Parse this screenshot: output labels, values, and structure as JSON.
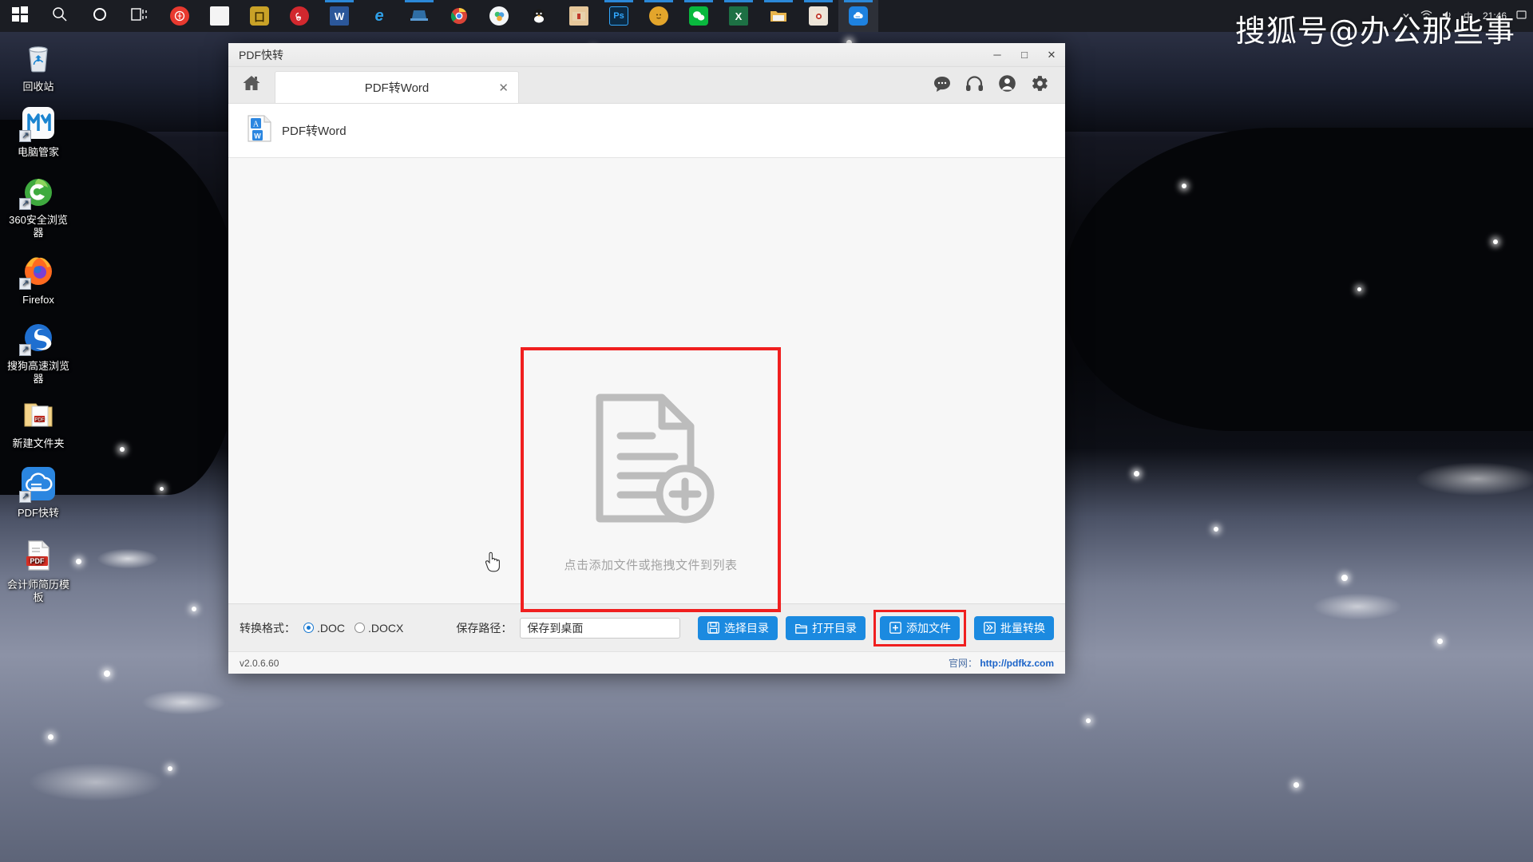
{
  "taskbar": {
    "start_label": "start-icon",
    "items": [
      {
        "name": "start",
        "glyph": "win",
        "color": "#ffffff",
        "running": false
      },
      {
        "name": "search",
        "glyph": "search",
        "color": "#ffffff",
        "running": false
      },
      {
        "name": "cortana",
        "glyph": "circle",
        "color": "#ffffff",
        "running": false
      },
      {
        "name": "task-view",
        "glyph": "taskview",
        "color": "#ffffff",
        "running": false
      },
      {
        "name": "adobe-acrobat",
        "glyph": "A",
        "color": "#e8392f",
        "running": false
      },
      {
        "name": "notepad",
        "glyph": "doc",
        "color": "#f0f0f0",
        "running": false
      },
      {
        "name": "sogou-input",
        "glyph": "S",
        "color": "#c9a227",
        "running": false
      },
      {
        "name": "netease-music",
        "glyph": "M",
        "color": "#d2282e",
        "running": false
      },
      {
        "name": "word",
        "glyph": "W",
        "color": "#2b579a",
        "running": true
      },
      {
        "name": "edge",
        "glyph": "e",
        "color": "#1477c4",
        "running": false
      },
      {
        "name": "desktop-app",
        "glyph": "L",
        "color": "#2f6ea5",
        "running": true
      },
      {
        "name": "chrome",
        "glyph": "C",
        "color": "#ffffff",
        "running": false
      },
      {
        "name": "360-browser",
        "glyph": "3",
        "color": "#ffffff",
        "running": false
      },
      {
        "name": "qq",
        "glyph": "Q",
        "color": "#1c1c1c",
        "running": false
      },
      {
        "name": "folder-pink",
        "glyph": "F",
        "color": "#e6c79a",
        "running": false
      },
      {
        "name": "photoshop",
        "glyph": "Ps",
        "color": "#0b2a44",
        "running": true
      },
      {
        "name": "yellow-face",
        "glyph": "Y",
        "color": "#e3a52b",
        "running": true
      },
      {
        "name": "wechat",
        "glyph": "W",
        "color": "#09b83e",
        "running": true
      },
      {
        "name": "excel",
        "glyph": "X",
        "color": "#1d7044",
        "running": true
      },
      {
        "name": "file-explorer",
        "glyph": "E",
        "color": "#e8b44c",
        "running": true
      },
      {
        "name": "photos",
        "glyph": "P",
        "color": "#ece4d8",
        "running": true
      },
      {
        "name": "pdf-kuaizhuan",
        "glyph": "K",
        "color": "#1e82e0",
        "running": true,
        "active": true
      }
    ],
    "tray": {
      "ime": "中",
      "clock": "21:46"
    }
  },
  "desktop_icons": [
    {
      "label": "回收站",
      "kind": "recycle-bin",
      "shortcut": false
    },
    {
      "label": "电脑管家",
      "kind": "pc-manager",
      "shortcut": true
    },
    {
      "label": "360安全浏览\n器",
      "kind": "360-browser",
      "shortcut": true
    },
    {
      "label": "Firefox",
      "kind": "firefox",
      "shortcut": true
    },
    {
      "label": "搜狗高速浏览\n器",
      "kind": "sogou-browser",
      "shortcut": true
    },
    {
      "label": "新建文件夹",
      "kind": "folder",
      "shortcut": false
    },
    {
      "label": "PDF快转",
      "kind": "pdf-kuaizhuan",
      "shortcut": true
    },
    {
      "label": "会计师简历模\n板",
      "kind": "pdf-file",
      "shortcut": false
    }
  ],
  "watermark": "搜狐号@办公那些事",
  "app": {
    "title": "PDF快转",
    "window_buttons": {
      "minimize": "─",
      "maximize": "□",
      "close": "✕"
    },
    "home_icon": "home-icon",
    "tab": {
      "label": "PDF转Word",
      "close": "✕"
    },
    "toolbar_icons": [
      {
        "name": "chat-bubble-icon"
      },
      {
        "name": "headphones-icon"
      },
      {
        "name": "user-account-icon"
      },
      {
        "name": "settings-gear-icon"
      }
    ],
    "file_type": {
      "label": "PDF转Word",
      "icon": "pdf-to-word-icon"
    },
    "dropzone": {
      "text": "点击添加文件或拖拽文件到列表",
      "icon": "add-document-icon",
      "highlighted": true,
      "highlight_color": "#f01f1f"
    },
    "bottom_bar": {
      "format_label": "转换格式：",
      "format_options": [
        {
          "label": ".DOC",
          "selected": true
        },
        {
          "label": ".DOCX",
          "selected": false
        }
      ],
      "path_label": "保存路径：",
      "path_value": "保存到桌面",
      "path_placeholder": "保存到桌面",
      "buttons": [
        {
          "label": "选择目录",
          "icon": "save-disk-icon",
          "highlighted": false
        },
        {
          "label": "打开目录",
          "icon": "open-folder-icon",
          "highlighted": false
        },
        {
          "label": "添加文件",
          "icon": "plus-square-icon",
          "highlighted": true
        },
        {
          "label": "批量转换",
          "icon": "batch-convert-icon",
          "highlighted": false
        }
      ],
      "accent_color": "#1b8ae0"
    },
    "status_bar": {
      "version": "v2.0.6.60",
      "site_label": "官网：",
      "site_url": "http://pdfkz.com"
    }
  }
}
